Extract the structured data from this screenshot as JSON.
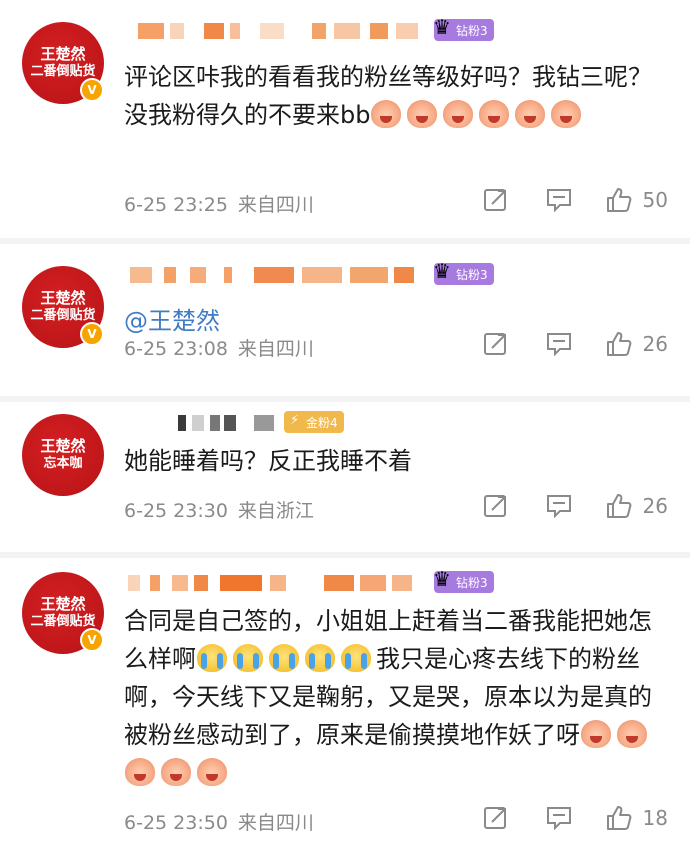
{
  "comments": [
    {
      "avatar": {
        "line1": "王楚然",
        "line2": "二番倒贴货",
        "verified": "V"
      },
      "badge": {
        "label": "钻粉3",
        "color": "#a77ae0",
        "icon": "crown-icon"
      },
      "text": "评论区咔我的看看我的粉丝等级好吗？我钻三呢？没我粉得久的不要来bb",
      "emojis_after": [
        "pig-laugh-icon",
        "pig-laugh-icon",
        "pig-laugh-icon",
        "pig-laugh-icon",
        "pig-laugh-icon",
        "pig-laugh-icon"
      ],
      "time": "6-25 23:25",
      "location": "来自四川",
      "likes": "50"
    },
    {
      "avatar": {
        "line1": "王楚然",
        "line2": "二番倒贴货",
        "verified": "V"
      },
      "badge": {
        "label": "钻粉3",
        "color": "#a77ae0",
        "icon": "crown-icon"
      },
      "mention": "@王楚然",
      "time": "6-25 23:08",
      "location": "来自四川",
      "likes": "26"
    },
    {
      "avatar": {
        "line1": "王楚然",
        "line2": "忘本咖"
      },
      "badge": {
        "label": "金粉4",
        "color": "#f1b84b",
        "icon": "bolt-icon"
      },
      "text": "她能睡着吗？反正我睡不着",
      "time": "6-25 23:30",
      "location": "来自浙江",
      "likes": "26"
    },
    {
      "avatar": {
        "line1": "王楚然",
        "line2": "二番倒贴货",
        "verified": "V"
      },
      "badge": {
        "label": "钻粉3",
        "color": "#a77ae0",
        "icon": "crown-icon"
      },
      "text_part1": "合同是自己签的，小姐姐上赶着当二番我能把她怎么样啊",
      "text_part2": "我只是心疼去线下的粉丝啊，今天线下又是鞠躬，又是哭，原本以为是真的被粉丝感动到了，原来是偷摸摸地作妖了呀",
      "time": "6-25 23:50",
      "location": "来自四川",
      "likes": "18"
    }
  ],
  "colors": {
    "accent_link": "#3f7cc6",
    "avatar_red": "#c0171a",
    "meta_gray": "#8a8a8a"
  }
}
